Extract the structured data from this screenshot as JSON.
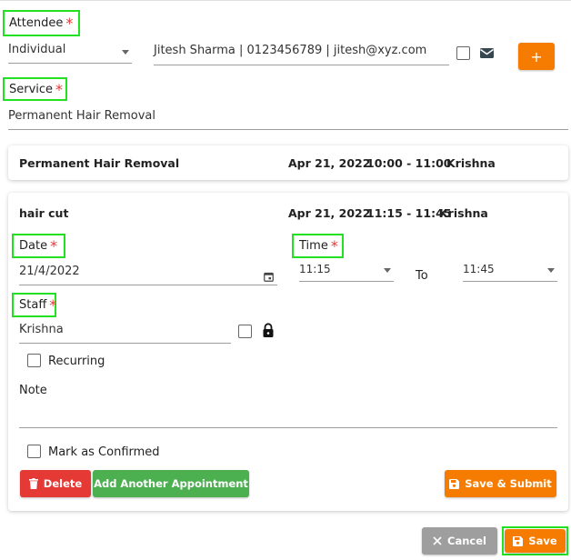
{
  "attendee": {
    "label": "Attendee",
    "required": "*",
    "type_value": "Individual",
    "contact_value": "Jitesh Sharma | 0123456789 | jitesh@xyz.com",
    "add_label": "+"
  },
  "service": {
    "label": "Service",
    "required": "*",
    "value": "Permanent Hair Removal"
  },
  "appointments": [
    {
      "service": "Permanent Hair Removal",
      "date": "Apr 21, 2022",
      "time": "10:00 - 11:00",
      "staff": "Krishna"
    },
    {
      "service": "hair cut",
      "date": "Apr 21, 2022",
      "time": "11:15 - 11:45",
      "staff": "Krishna"
    }
  ],
  "form": {
    "date_label": "Date",
    "date_value": "21/4/2022",
    "time_label": "Time",
    "time_from": "11:15",
    "to_label": "To",
    "time_to": "11:45",
    "staff_label": "Staff",
    "staff_value": "Krishna",
    "recurring_label": "Recurring",
    "note_label": "Note",
    "confirmed_label": "Mark as Confirmed",
    "required": "*"
  },
  "buttons": {
    "delete": "Delete",
    "add_another": "Add Another Appointment",
    "save_submit": "Save & Submit",
    "cancel": "Cancel",
    "save": "Save"
  },
  "colors": {
    "orange": "#f57c00",
    "red": "#e53935",
    "green": "#4caf50",
    "grey": "#9e9e9e",
    "highlight": "#22e022"
  }
}
